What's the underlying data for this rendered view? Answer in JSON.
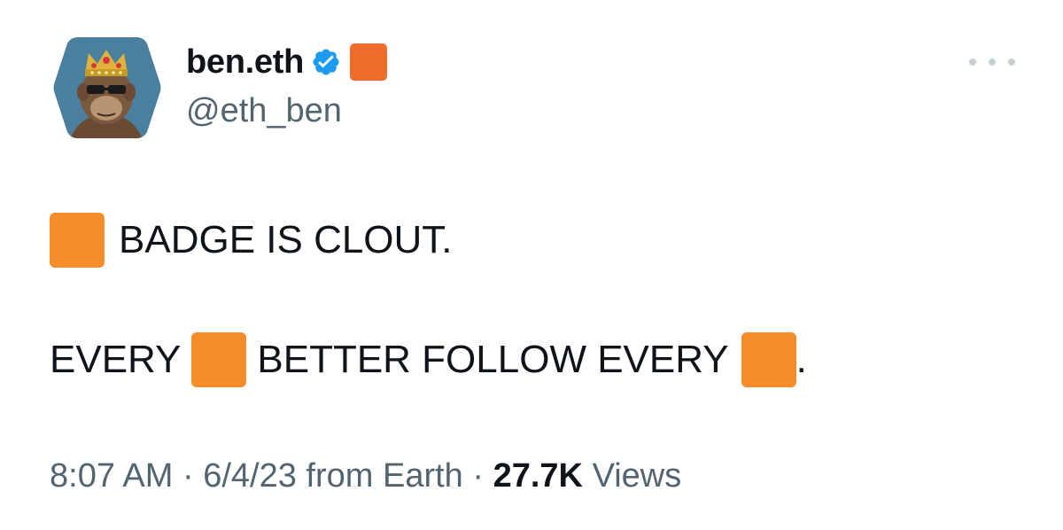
{
  "author": {
    "display_name": "ben.eth",
    "handle": "@eth_ben",
    "avatar_icon": "bored-ape-avatar-icon",
    "verified_icon": "verified-badge-icon"
  },
  "tweet": {
    "line1_text": "BADGE IS CLOUT.",
    "line2_part1": "EVERY",
    "line2_part2": "BETTER FOLLOW EVERY",
    "line2_part3": ".",
    "emoji": "orange-square-emoji"
  },
  "meta": {
    "time": "8:07 AM",
    "sep1": "·",
    "date": "6/4/23",
    "source": "from Earth",
    "sep2": "·",
    "views_count": "27.7K",
    "views_label": "Views"
  },
  "colors": {
    "verified": "#1d9bf0",
    "badge": "#ef6d2c",
    "emoji_orange": "#f78c2b",
    "secondary_text": "#536471"
  }
}
